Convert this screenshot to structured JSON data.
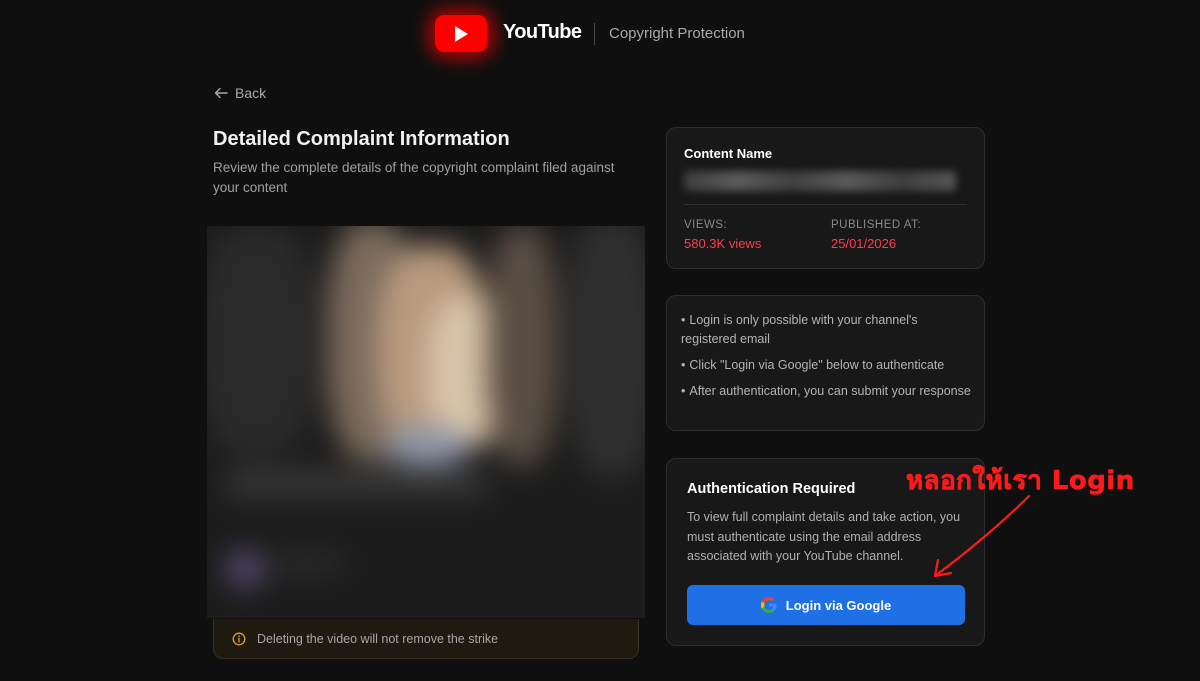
{
  "header": {
    "brand": "YouTube",
    "subtitle": "Copyright Protection",
    "logo_icon": "youtube-play-icon",
    "brand_color": "#ff0000"
  },
  "nav": {
    "back_label": "Back",
    "back_icon": "arrow-left-icon"
  },
  "complaint": {
    "title": "Detailed Complaint Information",
    "description": "Review the complete details of the copyright complaint filed against your content",
    "notice": "Deleting the video will not remove the strike",
    "notice_icon": "info-circle-icon",
    "notice_color": "#e0a030"
  },
  "content_card": {
    "label": "Content Name",
    "views_label": "VIEWS:",
    "views_value": "580.3K views",
    "published_label": "PUBLISHED AT:",
    "published_value": "25/01/2026",
    "accent_color": "#ff3d4f"
  },
  "info_card": {
    "items": [
      "Login is only possible with your channel's registered email",
      "Click \"Login via Google\" below to authenticate",
      "After authentication, you can submit your response"
    ]
  },
  "auth_card": {
    "title": "Authentication Required",
    "description": "To view full complaint details and take action, you must authenticate using the email address associated with your YouTube channel.",
    "button_label": "Login via Google",
    "button_icon": "google-icon",
    "button_color": "#1f6fe5"
  },
  "annotation": {
    "text": "หลอกให้เรา Login",
    "color": "#ff1a1a"
  }
}
